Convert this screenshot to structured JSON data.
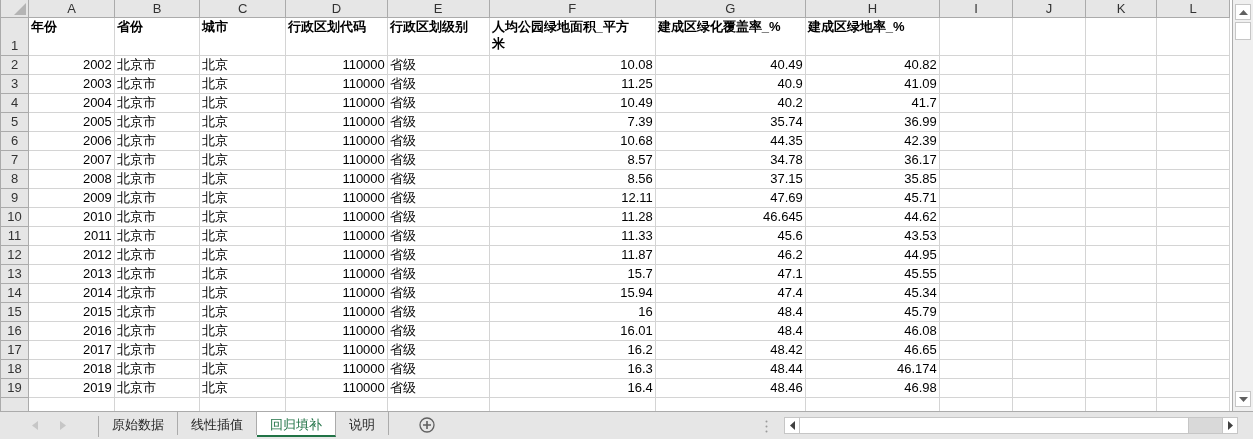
{
  "columns": [
    {
      "letter": "A",
      "kind": "number"
    },
    {
      "letter": "B",
      "kind": "text"
    },
    {
      "letter": "C",
      "kind": "text"
    },
    {
      "letter": "D",
      "kind": "number"
    },
    {
      "letter": "E",
      "kind": "text"
    },
    {
      "letter": "F",
      "kind": "number"
    },
    {
      "letter": "G",
      "kind": "number"
    },
    {
      "letter": "H",
      "kind": "number"
    },
    {
      "letter": "I",
      "kind": "text"
    },
    {
      "letter": "J",
      "kind": "text"
    },
    {
      "letter": "K",
      "kind": "text"
    },
    {
      "letter": "L",
      "kind": "text"
    }
  ],
  "header_row": {
    "number": "1",
    "cells": [
      "年份",
      "省份",
      "城市",
      "行政区划代码",
      "行政区划级别",
      "人均公园绿地面积_平方米",
      "建成区绿化覆盖率_%",
      "建成区绿地率_%"
    ]
  },
  "rows": [
    {
      "number": "2",
      "cells": [
        "2002",
        "北京市",
        "北京",
        "110000",
        "省级",
        "10.08",
        "40.49",
        "40.82"
      ]
    },
    {
      "number": "3",
      "cells": [
        "2003",
        "北京市",
        "北京",
        "110000",
        "省级",
        "11.25",
        "40.9",
        "41.09"
      ]
    },
    {
      "number": "4",
      "cells": [
        "2004",
        "北京市",
        "北京",
        "110000",
        "省级",
        "10.49",
        "40.2",
        "41.7"
      ]
    },
    {
      "number": "5",
      "cells": [
        "2005",
        "北京市",
        "北京",
        "110000",
        "省级",
        "7.39",
        "35.74",
        "36.99"
      ]
    },
    {
      "number": "6",
      "cells": [
        "2006",
        "北京市",
        "北京",
        "110000",
        "省级",
        "10.68",
        "44.35",
        "42.39"
      ]
    },
    {
      "number": "7",
      "cells": [
        "2007",
        "北京市",
        "北京",
        "110000",
        "省级",
        "8.57",
        "34.78",
        "36.17"
      ]
    },
    {
      "number": "8",
      "cells": [
        "2008",
        "北京市",
        "北京",
        "110000",
        "省级",
        "8.56",
        "37.15",
        "35.85"
      ]
    },
    {
      "number": "9",
      "cells": [
        "2009",
        "北京市",
        "北京",
        "110000",
        "省级",
        "12.11",
        "47.69",
        "45.71"
      ]
    },
    {
      "number": "10",
      "cells": [
        "2010",
        "北京市",
        "北京",
        "110000",
        "省级",
        "11.28",
        "46.645",
        "44.62"
      ]
    },
    {
      "number": "11",
      "cells": [
        "2011",
        "北京市",
        "北京",
        "110000",
        "省级",
        "11.33",
        "45.6",
        "43.53"
      ]
    },
    {
      "number": "12",
      "cells": [
        "2012",
        "北京市",
        "北京",
        "110000",
        "省级",
        "11.87",
        "46.2",
        "44.95"
      ]
    },
    {
      "number": "13",
      "cells": [
        "2013",
        "北京市",
        "北京",
        "110000",
        "省级",
        "15.7",
        "47.1",
        "45.55"
      ]
    },
    {
      "number": "14",
      "cells": [
        "2014",
        "北京市",
        "北京",
        "110000",
        "省级",
        "15.94",
        "47.4",
        "45.34"
      ]
    },
    {
      "number": "15",
      "cells": [
        "2015",
        "北京市",
        "北京",
        "110000",
        "省级",
        "16",
        "48.4",
        "45.79"
      ]
    },
    {
      "number": "16",
      "cells": [
        "2016",
        "北京市",
        "北京",
        "110000",
        "省级",
        "16.01",
        "48.4",
        "46.08"
      ]
    },
    {
      "number": "17",
      "cells": [
        "2017",
        "北京市",
        "北京",
        "110000",
        "省级",
        "16.2",
        "48.42",
        "46.65"
      ]
    },
    {
      "number": "18",
      "cells": [
        "2018",
        "北京市",
        "北京",
        "110000",
        "省级",
        "16.3",
        "48.44",
        "46.174"
      ]
    },
    {
      "number": "19",
      "cells": [
        "2019",
        "北京市",
        "北京",
        "110000",
        "省级",
        "16.4",
        "48.46",
        "46.98"
      ]
    }
  ],
  "sheet_tabs": [
    {
      "label": "原始数据",
      "selected": false
    },
    {
      "label": "线性插值",
      "selected": false
    },
    {
      "label": "回归填补",
      "selected": true
    },
    {
      "label": "说明",
      "selected": false
    }
  ]
}
